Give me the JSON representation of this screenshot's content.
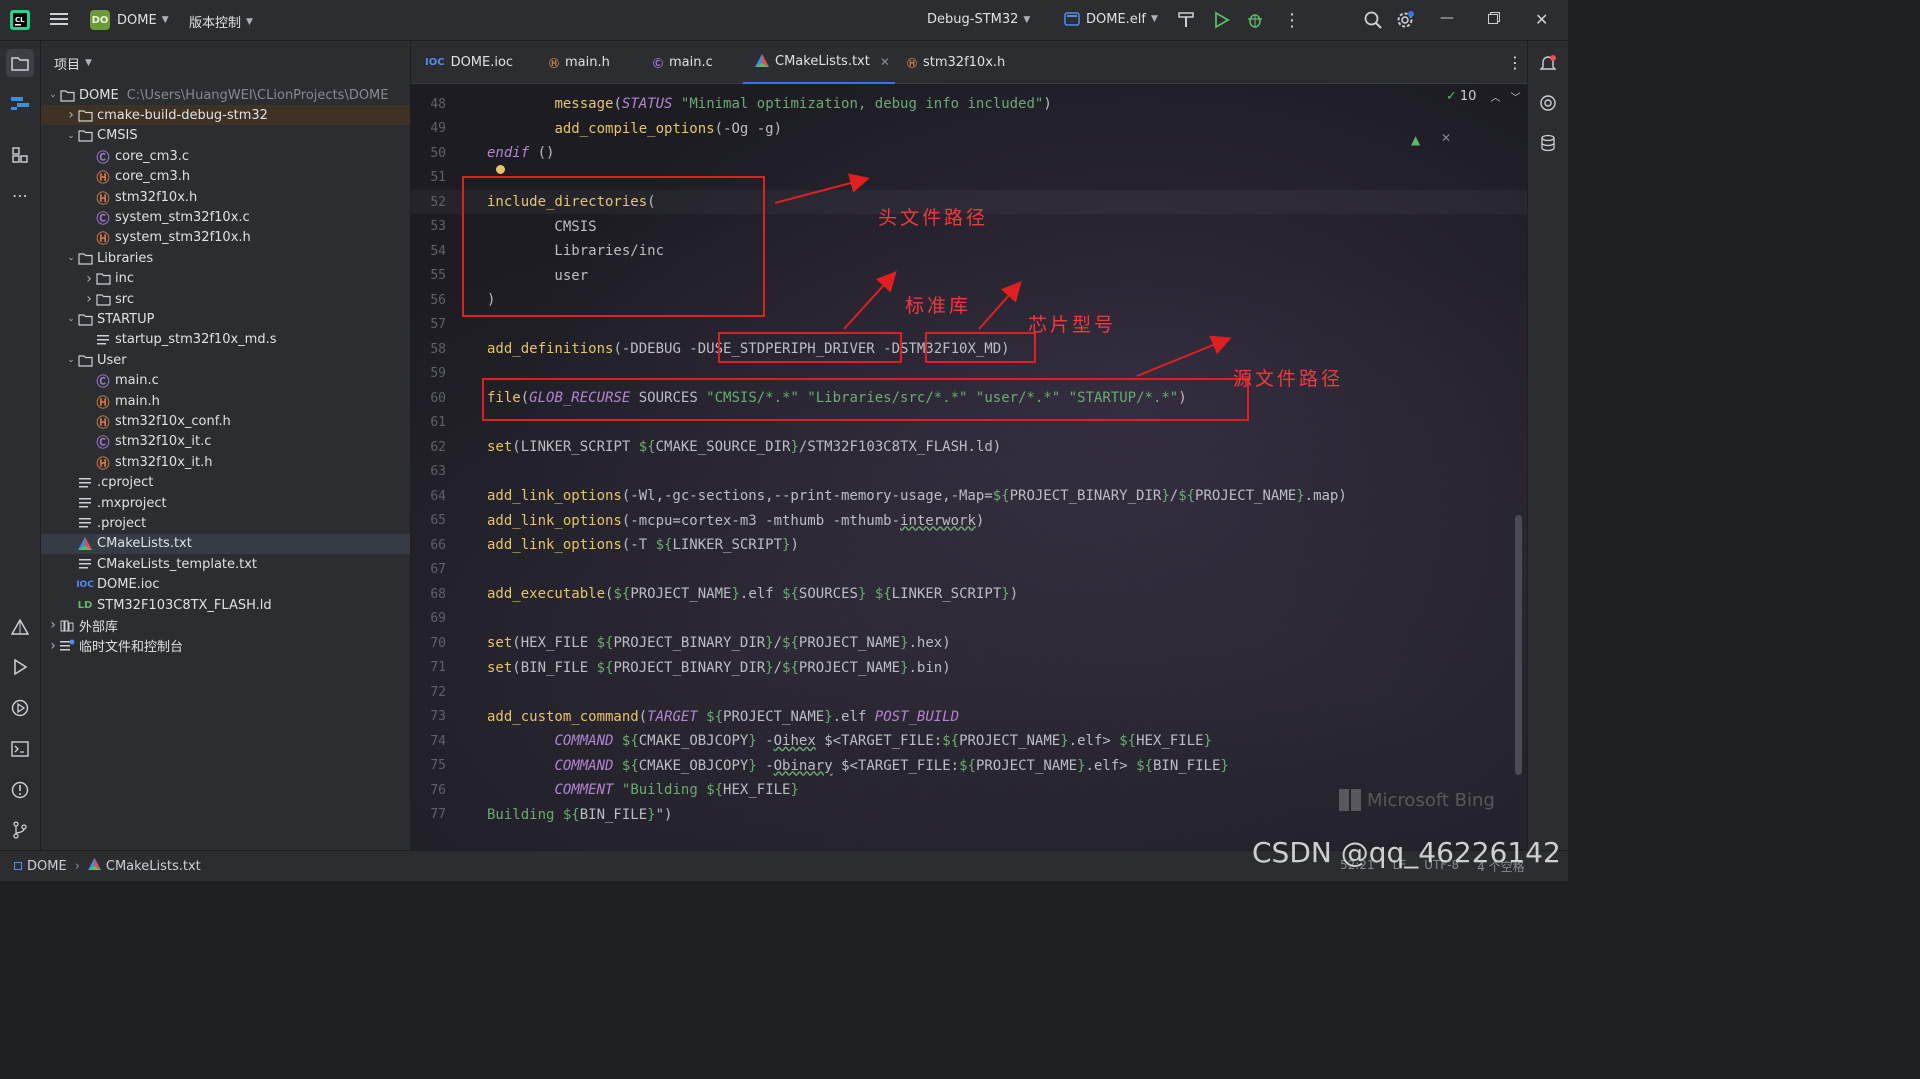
{
  "titlebar": {
    "project_badge": "DO",
    "project_name": "DOME",
    "vcs_menu": "版本控制",
    "run_config": "Debug-STM32",
    "target": "DOME.elf"
  },
  "project_panel": {
    "header": "项目",
    "tree": [
      {
        "label": "DOME",
        "hint": "C:\\Users\\HuangWEI\\CLionProjects\\DOME",
        "level": 0,
        "arrow": "down",
        "icon": "folder"
      },
      {
        "label": "cmake-build-debug-stm32",
        "level": 1,
        "arrow": "right",
        "icon": "folder",
        "highlighted": true
      },
      {
        "label": "CMSIS",
        "level": 1,
        "arrow": "down",
        "icon": "folder"
      },
      {
        "label": "core_cm3.c",
        "level": 2,
        "icon": "c"
      },
      {
        "label": "core_cm3.h",
        "level": 2,
        "icon": "h"
      },
      {
        "label": "stm32f10x.h",
        "level": 2,
        "icon": "h"
      },
      {
        "label": "system_stm32f10x.c",
        "level": 2,
        "icon": "c"
      },
      {
        "label": "system_stm32f10x.h",
        "level": 2,
        "icon": "h"
      },
      {
        "label": "Libraries",
        "level": 1,
        "arrow": "down",
        "icon": "folder"
      },
      {
        "label": "inc",
        "level": 2,
        "arrow": "right",
        "icon": "folder"
      },
      {
        "label": "src",
        "level": 2,
        "arrow": "right",
        "icon": "folder"
      },
      {
        "label": "STARTUP",
        "level": 1,
        "arrow": "down",
        "icon": "folder"
      },
      {
        "label": "startup_stm32f10x_md.s",
        "level": 2,
        "icon": "text"
      },
      {
        "label": "User",
        "level": 1,
        "arrow": "down",
        "icon": "folder"
      },
      {
        "label": "main.c",
        "level": 2,
        "icon": "c"
      },
      {
        "label": "main.h",
        "level": 2,
        "icon": "h"
      },
      {
        "label": "stm32f10x_conf.h",
        "level": 2,
        "icon": "h"
      },
      {
        "label": "stm32f10x_it.c",
        "level": 2,
        "icon": "c"
      },
      {
        "label": "stm32f10x_it.h",
        "level": 2,
        "icon": "h"
      },
      {
        "label": ".cproject",
        "level": 1,
        "icon": "text"
      },
      {
        "label": ".mxproject",
        "level": 1,
        "icon": "text"
      },
      {
        "label": ".project",
        "level": 1,
        "icon": "text"
      },
      {
        "label": "CMakeLists.txt",
        "level": 1,
        "icon": "cmake",
        "selected": true
      },
      {
        "label": "CMakeLists_template.txt",
        "level": 1,
        "icon": "text"
      },
      {
        "label": "DOME.ioc",
        "level": 1,
        "icon": "ioc"
      },
      {
        "label": "STM32F103C8TX_FLASH.ld",
        "level": 1,
        "icon": "ld"
      },
      {
        "label": "外部库",
        "level": 0,
        "arrow": "right",
        "icon": "lib"
      },
      {
        "label": "临时文件和控制台",
        "level": 0,
        "arrow": "right",
        "icon": "scratch"
      }
    ]
  },
  "tabs": [
    {
      "label": "DOME.ioc",
      "icon": "ioc"
    },
    {
      "label": "main.h",
      "icon": "h"
    },
    {
      "label": "main.c",
      "icon": "c"
    },
    {
      "label": "CMakeLists.txt",
      "icon": "cmake",
      "active": true
    },
    {
      "label": "stm32f10x.h",
      "icon": "h"
    }
  ],
  "inspection": {
    "count": "10"
  },
  "code_lines": [
    {
      "n": "48",
      "segs": [
        [
          "        ",
          ""
        ],
        [
          "message",
          "fn"
        ],
        [
          "(",
          ""
        ],
        [
          "STATUS",
          "it"
        ],
        [
          " ",
          ""
        ],
        [
          "\"Minimal optimization, debug info included\"",
          "s"
        ],
        [
          ")",
          ""
        ]
      ]
    },
    {
      "n": "49",
      "segs": [
        [
          "        ",
          ""
        ],
        [
          "add_compile_options",
          "fn"
        ],
        [
          "(-Og -g)",
          ""
        ]
      ]
    },
    {
      "n": "50",
      "segs": [
        [
          "endif",
          "it"
        ],
        [
          " ()",
          ""
        ]
      ]
    },
    {
      "n": "51",
      "segs": []
    },
    {
      "n": "52",
      "segs": [
        [
          "include_directories",
          "fn"
        ],
        [
          "(",
          ""
        ]
      ],
      "current": true
    },
    {
      "n": "53",
      "segs": [
        [
          "        CMSIS",
          ""
        ]
      ]
    },
    {
      "n": "54",
      "segs": [
        [
          "        Libraries/inc",
          ""
        ]
      ]
    },
    {
      "n": "55",
      "segs": [
        [
          "        user",
          ""
        ]
      ]
    },
    {
      "n": "56",
      "segs": [
        [
          ")",
          ""
        ]
      ]
    },
    {
      "n": "57",
      "segs": []
    },
    {
      "n": "58",
      "segs": [
        [
          "add_definitions",
          "fn"
        ],
        [
          "(-DDEBUG -DUSE_STDPERIPH_DRIVER -DSTM32F10X_MD)",
          ""
        ]
      ]
    },
    {
      "n": "59",
      "segs": []
    },
    {
      "n": "60",
      "segs": [
        [
          "file",
          "fn"
        ],
        [
          "(",
          ""
        ],
        [
          "GLOB_RECURSE",
          "it"
        ],
        [
          " SOURCES ",
          ""
        ],
        [
          "\"CMSIS/*.*\"",
          "s"
        ],
        [
          " ",
          ""
        ],
        [
          "\"Libraries/src/*.*\"",
          "s"
        ],
        [
          " ",
          ""
        ],
        [
          "\"user/*.*\"",
          "s"
        ],
        [
          " ",
          ""
        ],
        [
          "\"STARTUP/*.*\"",
          "s"
        ],
        [
          ")",
          ""
        ]
      ]
    },
    {
      "n": "61",
      "segs": []
    },
    {
      "n": "62",
      "segs": [
        [
          "set",
          "fn"
        ],
        [
          "(LINKER_SCRIPT ",
          ""
        ],
        [
          "${",
          "s"
        ],
        [
          "CMAKE_SOURCE_DIR",
          ""
        ],
        [
          "}",
          "s"
        ],
        [
          "/STM32F103C8TX_FLASH.ld)",
          ""
        ]
      ]
    },
    {
      "n": "63",
      "segs": []
    },
    {
      "n": "64",
      "segs": [
        [
          "add_link_options",
          "fn"
        ],
        [
          "(-Wl,-gc-sections,--print-memory-usage,-Map=",
          ""
        ],
        [
          "${",
          "s"
        ],
        [
          "PROJECT_BINARY_DIR",
          ""
        ],
        [
          "}",
          "s"
        ],
        [
          "/",
          ""
        ],
        [
          "${",
          "s"
        ],
        [
          "PROJECT_NAME",
          ""
        ],
        [
          "}",
          "s"
        ],
        [
          ".map)",
          ""
        ]
      ]
    },
    {
      "n": "65",
      "segs": [
        [
          "add_link_options",
          "fn"
        ],
        [
          "(-mcpu=cortex-m3 -mthumb -mthumb-",
          ""
        ],
        [
          "interwork",
          "u"
        ],
        [
          ")",
          ""
        ]
      ]
    },
    {
      "n": "66",
      "segs": [
        [
          "add_link_options",
          "fn"
        ],
        [
          "(-T ",
          ""
        ],
        [
          "${",
          "s"
        ],
        [
          "LINKER_SCRIPT",
          ""
        ],
        [
          "}",
          "s"
        ],
        [
          ")",
          ""
        ]
      ]
    },
    {
      "n": "67",
      "segs": []
    },
    {
      "n": "68",
      "segs": [
        [
          "add_executable",
          "fn"
        ],
        [
          "(",
          ""
        ],
        [
          "${",
          "s"
        ],
        [
          "PROJECT_NAME",
          ""
        ],
        [
          "}",
          "s"
        ],
        [
          ".elf ",
          ""
        ],
        [
          "${",
          "s"
        ],
        [
          "SOURCES",
          ""
        ],
        [
          "}",
          "s"
        ],
        [
          " ",
          ""
        ],
        [
          "${",
          "s"
        ],
        [
          "LINKER_SCRIPT",
          ""
        ],
        [
          "}",
          "s"
        ],
        [
          ")",
          ""
        ]
      ]
    },
    {
      "n": "69",
      "segs": []
    },
    {
      "n": "70",
      "segs": [
        [
          "set",
          "fn"
        ],
        [
          "(HEX_FILE ",
          ""
        ],
        [
          "${",
          "s"
        ],
        [
          "PROJECT_BINARY_DIR",
          ""
        ],
        [
          "}",
          "s"
        ],
        [
          "/",
          ""
        ],
        [
          "${",
          "s"
        ],
        [
          "PROJECT_NAME",
          ""
        ],
        [
          "}",
          "s"
        ],
        [
          ".hex)",
          ""
        ]
      ]
    },
    {
      "n": "71",
      "segs": [
        [
          "set",
          "fn"
        ],
        [
          "(BIN_FILE ",
          ""
        ],
        [
          "${",
          "s"
        ],
        [
          "PROJECT_BINARY_DIR",
          ""
        ],
        [
          "}",
          "s"
        ],
        [
          "/",
          ""
        ],
        [
          "${",
          "s"
        ],
        [
          "PROJECT_NAME",
          ""
        ],
        [
          "}",
          "s"
        ],
        [
          ".bin)",
          ""
        ]
      ]
    },
    {
      "n": "72",
      "segs": []
    },
    {
      "n": "73",
      "segs": [
        [
          "add_custom_command",
          "fn"
        ],
        [
          "(",
          ""
        ],
        [
          "TARGET",
          "it"
        ],
        [
          " ",
          ""
        ],
        [
          "${",
          "s"
        ],
        [
          "PROJECT_NAME",
          ""
        ],
        [
          "}",
          "s"
        ],
        [
          ".elf ",
          ""
        ],
        [
          "POST_BUILD",
          "it"
        ]
      ]
    },
    {
      "n": "74",
      "segs": [
        [
          "        ",
          ""
        ],
        [
          "COMMAND",
          "it"
        ],
        [
          " ",
          ""
        ],
        [
          "${",
          "s"
        ],
        [
          "CMAKE_OBJCOPY",
          ""
        ],
        [
          "}",
          "s"
        ],
        [
          " -",
          ""
        ],
        [
          "Oihex",
          "u"
        ],
        [
          " $<TARGET_FILE:",
          ""
        ],
        [
          "${",
          "s"
        ],
        [
          "PROJECT_NAME",
          ""
        ],
        [
          "}",
          "s"
        ],
        [
          ".elf> ",
          ""
        ],
        [
          "${",
          "s"
        ],
        [
          "HEX_FILE",
          ""
        ],
        [
          "}",
          "s"
        ]
      ]
    },
    {
      "n": "75",
      "segs": [
        [
          "        ",
          ""
        ],
        [
          "COMMAND",
          "it"
        ],
        [
          " ",
          ""
        ],
        [
          "${",
          "s"
        ],
        [
          "CMAKE_OBJCOPY",
          ""
        ],
        [
          "}",
          "s"
        ],
        [
          " -",
          ""
        ],
        [
          "Obinary",
          "u"
        ],
        [
          " $<TARGET_FILE:",
          ""
        ],
        [
          "${",
          "s"
        ],
        [
          "PROJECT_NAME",
          ""
        ],
        [
          "}",
          "s"
        ],
        [
          ".elf> ",
          ""
        ],
        [
          "${",
          "s"
        ],
        [
          "BIN_FILE",
          ""
        ],
        [
          "}",
          "s"
        ]
      ]
    },
    {
      "n": "76",
      "segs": [
        [
          "        ",
          ""
        ],
        [
          "COMMENT",
          "it"
        ],
        [
          " ",
          ""
        ],
        [
          "\"Building ",
          "s"
        ],
        [
          "${",
          "s"
        ],
        [
          "HEX_FILE",
          ""
        ],
        [
          "}",
          "s"
        ]
      ]
    },
    {
      "n": "77",
      "segs": [
        [
          "Building ",
          "s"
        ],
        [
          "${",
          "s"
        ],
        [
          "BIN_FILE",
          ""
        ],
        [
          "}",
          "s"
        ],
        [
          "\")",
          ""
        ]
      ]
    }
  ],
  "annotations": {
    "header_path": "头文件路径",
    "std_lib": "标准库",
    "chip_model": "芯片型号",
    "source_path": "源文件路径"
  },
  "status_bar": {
    "project": "DOME",
    "file": "CMakeLists.txt",
    "position": "52:21",
    "line_sep": "LF",
    "encoding": "UTF-8",
    "indent": "4 个空格"
  },
  "watermarks": {
    "csdn": "CSDN @qq_46226142",
    "bing": "Microsoft Bing"
  },
  "colors": {
    "accent": "#3574f0",
    "annotation_red": "#e02020",
    "keyword_fn": "#e8c46a",
    "string": "#6aab73",
    "italic_kw": "#b684d4"
  }
}
